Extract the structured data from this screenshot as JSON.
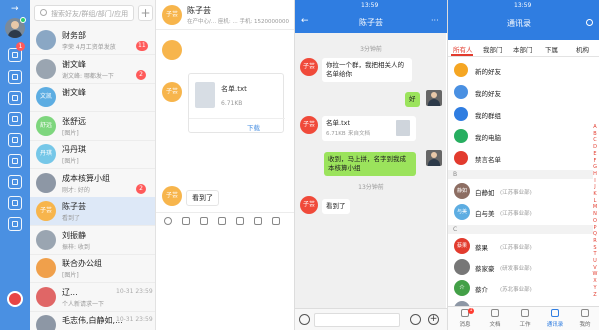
{
  "desktop": {
    "search": {
      "placeholder": "搜索好友/群组/部门/应用"
    },
    "conversations": [
      {
        "name": "财务部",
        "preview": "李荣 4月工资单发放",
        "time": "",
        "badge": "11",
        "avatar": "",
        "color": "#8aa7c4"
      },
      {
        "name": "谢文峰",
        "preview": "谢文峰: 哪都发一下",
        "time": "",
        "badge": "2",
        "avatar": "",
        "color": "#9aa5b1"
      },
      {
        "name": "谢文峰",
        "preview": "",
        "time": "",
        "badge": "",
        "avatar": "文凯",
        "color": "#5dade2"
      },
      {
        "name": "张舒远",
        "preview": "[图片]",
        "time": "",
        "badge": "",
        "avatar": "舒远",
        "color": "#7ed67e"
      },
      {
        "name": "冯丹琪",
        "preview": "[图片]",
        "time": "",
        "badge": "",
        "avatar": "丹琪",
        "color": "#76c7e8"
      },
      {
        "name": "成本核算小组",
        "preview": "刚才: 好的",
        "time": "",
        "badge": "2",
        "avatar": "",
        "color": "#8d97a5"
      },
      {
        "name": "陈子芸",
        "preview": "看到了",
        "time": "",
        "badge": "",
        "avatar": "子芸",
        "color": "#f7b54c"
      },
      {
        "name": "刘振静",
        "preview": "振梓: 收到",
        "time": "",
        "badge": "",
        "avatar": "",
        "color": "#9aa5b1"
      },
      {
        "name": "联合办公组",
        "preview": "[图片]",
        "time": "",
        "badge": "",
        "avatar": "",
        "color": "#f0a04b"
      },
      {
        "name": "辽...",
        "preview": "个人新请求一下",
        "time": "10-31 23:59",
        "badge": "",
        "avatar": "",
        "color": "#e06666"
      },
      {
        "name": "毛志伟,白静如,...",
        "preview": "",
        "time": "10-31 23:59",
        "badge": "",
        "avatar": "",
        "color": "#8d97a5"
      }
    ],
    "chat": {
      "name": "陈子芸",
      "sub": "在产中心/...   座机: ...  手机: 1520000000",
      "avatar": "子芸",
      "file_name": "名单.txt",
      "file_size": "6.71KB",
      "download": "下载",
      "last_msg": "看到了",
      "logout_label": "OFF"
    }
  },
  "phone_chat": {
    "status_time": "13:59",
    "title": "陈子芸",
    "back": "←",
    "more": "···",
    "messages": [
      {
        "kind": "time",
        "text": "3分钟前"
      },
      {
        "kind": "in",
        "text": "你拉一个群，我把相关人的名单给你"
      },
      {
        "kind": "out",
        "text": "好"
      },
      {
        "kind": "file",
        "name": "名单.txt",
        "size": "6.71KB",
        "origin": "来自文档"
      },
      {
        "kind": "out",
        "text": "收到，马上拼，名字到我成本核算小组"
      },
      {
        "kind": "time",
        "text": "13分钟前"
      },
      {
        "kind": "in",
        "text": "看到了"
      }
    ],
    "avatar_text": "子芸"
  },
  "phone_contacts": {
    "status_time": "13:59",
    "title": "通讯录",
    "tabs": [
      "所有人",
      "我部门",
      "本部门",
      "下属",
      "机构"
    ],
    "entries": [
      {
        "label": "新的好友",
        "color": "#f5a623"
      },
      {
        "label": "我的好友",
        "color": "#4a90e2"
      },
      {
        "label": "我的群组",
        "color": "#2f7de1"
      },
      {
        "label": "我的电脑",
        "color": "#27ae60"
      },
      {
        "label": "禁言名单",
        "color": "#e23b2e"
      }
    ],
    "sections": [
      {
        "letter": "B",
        "people": [
          {
            "name": "白静如",
            "dept": "(江苏事业部)",
            "av": "静如",
            "color": "#8d6e63"
          },
          {
            "name": "白与美",
            "dept": "(江苏事业部)",
            "av": "与美",
            "color": "#5dade2"
          }
        ]
      },
      {
        "letter": "C",
        "people": [
          {
            "name": "蔡果",
            "dept": "(江苏事业部)",
            "av": "蔡果",
            "color": "#e23b2e"
          },
          {
            "name": "蔡家豪",
            "dept": "(研发事业部)",
            "av": "",
            "color": "#777"
          },
          {
            "name": "蔡介",
            "dept": "(苏北事业部)",
            "av": "介",
            "color": "#43a047"
          },
          {
            "name": "蔡乐",
            "dept": "(江苏事业部)",
            "av": "",
            "color": "#8d97a5"
          }
        ]
      }
    ],
    "az": [
      "A",
      "B",
      "C",
      "D",
      "E",
      "F",
      "G",
      "H",
      "I",
      "J",
      "K",
      "L",
      "M",
      "N",
      "O",
      "P",
      "Q",
      "R",
      "S",
      "T",
      "U",
      "V",
      "W",
      "X",
      "Y",
      "Z"
    ],
    "nav": [
      {
        "label": "消息",
        "badge": "1"
      },
      {
        "label": "文档"
      },
      {
        "label": "工作"
      },
      {
        "label": "通讯录"
      },
      {
        "label": "我的"
      }
    ]
  }
}
